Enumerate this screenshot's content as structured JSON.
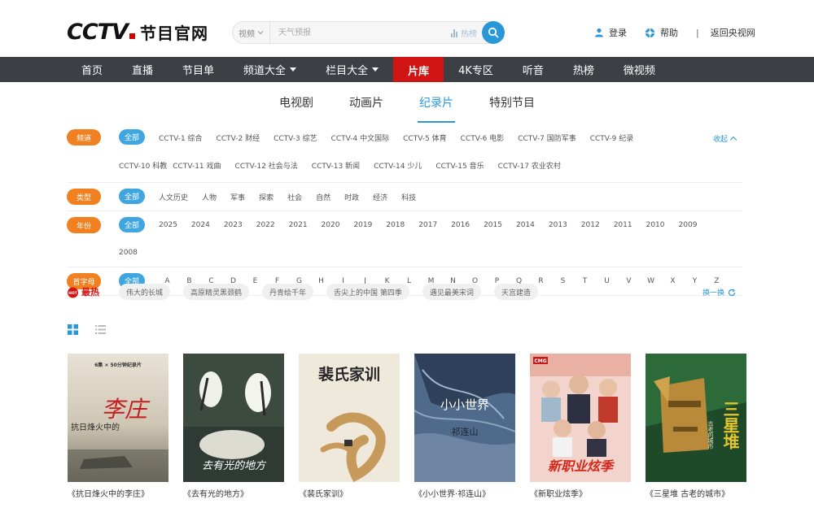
{
  "header": {
    "logo_cctv": "CCTV",
    "logo_sub": "节目官网",
    "search": {
      "type": "视频",
      "placeholder": "天气预报",
      "hot_label": "热榜"
    },
    "login": "登录",
    "help": "帮助",
    "separator": "|",
    "back_link": "返回央视网"
  },
  "nav": {
    "items": [
      {
        "label": "首页"
      },
      {
        "label": "直播"
      },
      {
        "label": "节目单"
      },
      {
        "label": "频道大全"
      },
      {
        "label": "栏目大全"
      },
      {
        "label": "片库"
      },
      {
        "label": "4K专区"
      },
      {
        "label": "听音"
      },
      {
        "label": "热榜"
      },
      {
        "label": "微视频"
      }
    ]
  },
  "subtabs": [
    {
      "label": "电视剧"
    },
    {
      "label": "动画片"
    },
    {
      "label": "纪录片"
    },
    {
      "label": "特别节目"
    }
  ],
  "filters": {
    "channel": {
      "label": "频道",
      "options": [
        "全部",
        "CCTV-1 综合",
        "CCTV-2 财经",
        "CCTV-3 综艺",
        "CCTV-4 中文国际",
        "CCTV-5 体育",
        "CCTV-6 电影",
        "CCTV-7 国防军事",
        "CCTV-9 纪录",
        "CCTV-10 科教",
        "CCTV-11 戏曲",
        "CCTV-12 社会与法",
        "CCTV-13 新闻",
        "CCTV-14 少儿",
        "CCTV-15 音乐",
        "CCTV-17 农业农村"
      ],
      "collapse": "收起"
    },
    "category": {
      "label": "类型",
      "options": [
        "全部",
        "人文历史",
        "人物",
        "军事",
        "探索",
        "社会",
        "自然",
        "时政",
        "经济",
        "科技"
      ]
    },
    "year": {
      "label": "年份",
      "options": [
        "全部",
        "2025",
        "2024",
        "2023",
        "2022",
        "2021",
        "2020",
        "2019",
        "2018",
        "2017",
        "2016",
        "2015",
        "2014",
        "2013",
        "2012",
        "2011",
        "2010",
        "2009",
        "2008"
      ]
    },
    "letter": {
      "label": "首字母",
      "options": [
        "全部",
        "A",
        "B",
        "C",
        "D",
        "E",
        "F",
        "G",
        "H",
        "I",
        "J",
        "K",
        "L",
        "M",
        "N",
        "O",
        "P",
        "Q",
        "R",
        "S",
        "T",
        "U",
        "V",
        "W",
        "X",
        "Y",
        "Z"
      ]
    }
  },
  "hot": {
    "badge_icon": "HOT",
    "label": "最热",
    "tags": [
      "伟大的长城",
      "高原精灵黑颈鹤",
      "丹青绘千年",
      "舌尖上的中国 第四季",
      "遇见最美宋词",
      "天宫建造"
    ],
    "refresh": "换一换"
  },
  "posters": [
    {
      "title": "《抗日烽火中的李庄》",
      "art_top": "6集 × 50分钟纪录片",
      "art_main": "李庄",
      "art_sub": "抗日烽火中的"
    },
    {
      "title": "《去有光的地方》",
      "art_main": "去有光的地方"
    },
    {
      "title": "《裴氏家训》",
      "art_main": "裴氏家训"
    },
    {
      "title": "《小小世界·祁连山》",
      "art_main": "小小世界",
      "art_sub": "祁连山"
    },
    {
      "title": "《新职业炫季》",
      "art_top": "CMG",
      "art_main": "新职业炫季"
    },
    {
      "title": "《三星堆 古老的城市》",
      "art_main": "三星堆",
      "art_sub": "古老的城市"
    }
  ],
  "colors": {
    "accent_blue": "#2a98d8",
    "nav_bg": "#3c3f44",
    "nav_active": "#d11515",
    "filter_label": "#f08020"
  }
}
